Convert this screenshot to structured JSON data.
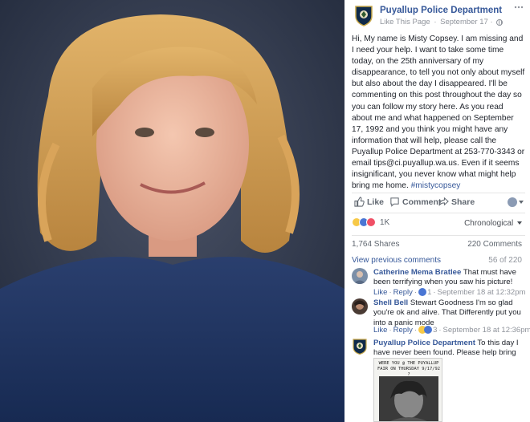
{
  "post": {
    "page_name": "Puyallup Police Department",
    "like_page": "Like This Page",
    "date": "September 17",
    "meta_sep": "·",
    "text_body": "Hi, My name is Misty Copsey. I am missing and I need your help. I want to take some time today, on the 25th anniversary of my disappearance, to tell you not only about myself but also about the day I disappeared. I'll be commenting on this post throughout the day so you can follow my story here. As you read about me and what happened on September 17, 1992 and you think you might have any information that will help, please call the Puyallup Police Department at 253-770-3343 or email tips@ci.puyallup.wa.us. Even if it seems insignificant, you never know what might help bring me home.",
    "hashtag": "#mistycopsey"
  },
  "actions": {
    "like": "Like",
    "comment": "Comment",
    "share": "Share"
  },
  "reactions": {
    "count": "1K",
    "sort_label": "Chronological"
  },
  "counts": {
    "shares": "1,764 Shares",
    "comments": "220 Comments"
  },
  "comments_nav": {
    "view_previous": "View previous comments",
    "pager": "56 of 220"
  },
  "comments": [
    {
      "author": "Catherine Mema Bratlee",
      "text": "That must have been terrifying when you saw his picture!",
      "like": "Like",
      "reply": "Reply",
      "reaction_count": "1",
      "time": "September 18 at 12:32pm"
    },
    {
      "author": "Shell Bell",
      "text": "Stewart Goodness I'm so glad you're ok and alive. That Differently put you into a panic mode",
      "like": "Like",
      "reply": "Reply",
      "reaction_count": "3",
      "time": "September 18 at 12:36pm"
    },
    {
      "author": "Puyallup Police Department",
      "text": "To this day I have never been found. Please help bring me home."
    }
  ],
  "clipping": {
    "handwriting": "WERE YOU @ THE PUYALLUP FAIR ON THURSDAY 9/17/92 ?"
  },
  "colors": {
    "link_blue": "#365899",
    "text": "#1d2129",
    "muted": "#90949c"
  }
}
